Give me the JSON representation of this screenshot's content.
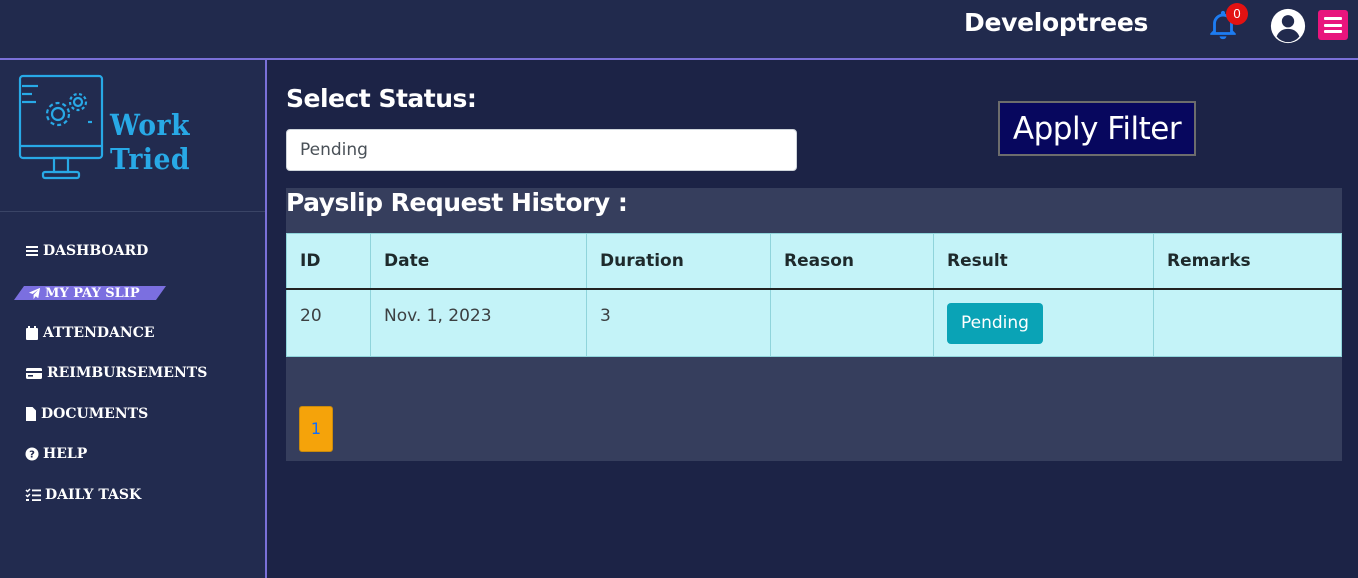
{
  "header": {
    "brand": "Developtrees",
    "notification_count": "0",
    "icons": [
      "bell-icon",
      "user-avatar-icon",
      "hamburger-menu-icon"
    ]
  },
  "sidebar": {
    "logo_text": "Work Tried",
    "items": [
      {
        "label": "DASHBOARD",
        "icon": "bars-icon"
      },
      {
        "label": "MY PAY SLIP",
        "icon": "paper-plane-icon",
        "active": true
      },
      {
        "label": "ATTENDANCE",
        "icon": "calendar-icon"
      },
      {
        "label": "REIMBURSEMENTS",
        "icon": "credit-card-icon"
      },
      {
        "label": "DOCUMENTS",
        "icon": "file-icon"
      },
      {
        "label": "HELP",
        "icon": "question-circle-icon"
      },
      {
        "label": "DAILY TASK",
        "icon": "tasks-list-icon"
      }
    ]
  },
  "filter": {
    "label": "Select Status:",
    "value": "Pending",
    "apply_label": "Apply Filter"
  },
  "history": {
    "title": "Payslip Request History :",
    "columns": [
      "ID",
      "Date",
      "Duration",
      "Reason",
      "Result",
      "Remarks"
    ],
    "rows": [
      {
        "id": "20",
        "date": "Nov. 1, 2023",
        "duration": "3",
        "reason": "",
        "result": "Pending",
        "remarks": ""
      }
    ]
  },
  "pagination": {
    "current": "1"
  },
  "colors": {
    "background": "#1c2346",
    "accent": "#7b6fe0",
    "table_bg": "#c4f3f8",
    "badge": "#0aa3b6",
    "apply_button": "#07075e",
    "pager": "#f5a30a"
  }
}
